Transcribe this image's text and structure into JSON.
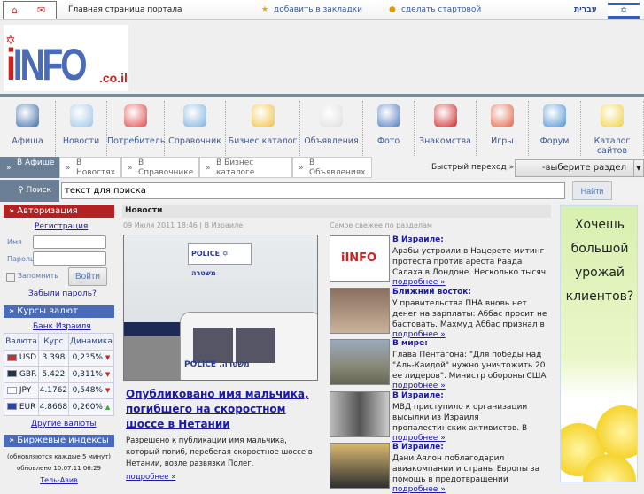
{
  "topbar": {
    "home_title": "Главная страница портала",
    "bookmark": "добавить в закладки",
    "startpage": "сделать стартовой",
    "hebrew": "עברית"
  },
  "logo": {
    "text": "iINFO",
    "suffix": ".co.il"
  },
  "nav": [
    {
      "label": "Афиша",
      "color": "#3a6aa8"
    },
    {
      "label": "Новости",
      "color": "#9cc4e6"
    },
    {
      "label": "Потребитель",
      "color": "#d44"
    },
    {
      "label": "Справочник",
      "color": "#7ab0dd"
    },
    {
      "label": "Бизнес каталог",
      "color": "#f0c040"
    },
    {
      "label": "Объявления",
      "color": "#ddd"
    },
    {
      "label": "Фото",
      "color": "#4a78c0"
    },
    {
      "label": "Знакомства",
      "color": "#cc2222"
    },
    {
      "label": "Игры",
      "color": "#e06040"
    },
    {
      "label": "Форум",
      "color": "#4a90d0"
    },
    {
      "label": "Каталог сайтов",
      "color": "#f0d040"
    }
  ],
  "tabs": [
    "В Афише",
    "В Новостях",
    "В Справочнике",
    "В Бизнес каталоге",
    "В Объявлениях"
  ],
  "quick": {
    "label": "Быстрый переход »",
    "select": "-выберите раздел"
  },
  "search": {
    "label": "Поиск",
    "value": "текст для поиска",
    "button": "Найти"
  },
  "auth": {
    "title": "Авторизация",
    "register": "Регистрация",
    "name": "Имя",
    "password": "Пароль",
    "remember": "Запомнить",
    "login": "Войти",
    "forgot": "Забыли пароль?"
  },
  "currency": {
    "title": "Курсы валют",
    "bank": "Банк Израиля",
    "headers": [
      "Валюта",
      "Курс",
      "Динамика"
    ],
    "rows": [
      {
        "code": "USD",
        "rate": "3.398",
        "change": "0,235%",
        "dir": "down"
      },
      {
        "code": "GBR",
        "rate": "5.422",
        "change": "0,311%",
        "dir": "down"
      },
      {
        "code": "JPY",
        "rate": "4.1762",
        "change": "0,548%",
        "dir": "down"
      },
      {
        "code": "EUR",
        "rate": "4.8668",
        "change": "0,260%",
        "dir": "up"
      }
    ],
    "other": "Другие валюты"
  },
  "indices": {
    "title": "Биржевые индексы",
    "note": "(обновляются каждые 5 минут)",
    "updated": "обновлено 10.07.11 06:29",
    "city": "Тель-Авив"
  },
  "main": {
    "title": "Новости",
    "meta": "09 Июля 2011 18:46 | В Израиле",
    "headline": "Опубликовано имя мальчика, погибшего на скоростном шоссе в Нетании",
    "summary": "Разрешено к публикации имя мальчика, который погиб, перебегая скоростное шоссе в Нетании, возле развязки Полег.",
    "more": "подробнее »"
  },
  "fresh": {
    "title": "Самое свежее по разделам",
    "items": [
      {
        "cat": "В Израиле:",
        "text": "Арабы устроили в Нацерете митинг протеста против ареста Раада Салаха в Лондоне. Несколько тысяч израильских",
        "more": "подробнее »"
      },
      {
        "cat": "Ближний восток:",
        "text": "У правительства ПНА вновь нет денег на зарплаты: Аббас просит не бастовать. Махмуд Аббас признал в субботу, что",
        "more": "подробнее »"
      },
      {
        "cat": "В мире:",
        "text": "Глава Пентагона: \"Для победы над \"Аль-Каидой\" нужно уничтожить 20 ее лидеров\". Министр обороны США Леон",
        "more": "подробнее »"
      },
      {
        "cat": "В Израиле:",
        "text": "МВД приступило к организации высылки из Израиля пропалестинских активистов. В субботу вечером",
        "more": "подробнее »"
      },
      {
        "cat": "В Израиле:",
        "text": "Дани Аялон поблагодарил авиакомпании и страны Европы за помощь в предотвращении провокации",
        "more": "подробнее »"
      }
    ]
  },
  "ad": {
    "text": "Хочешь большой урожай клиентов?"
  }
}
